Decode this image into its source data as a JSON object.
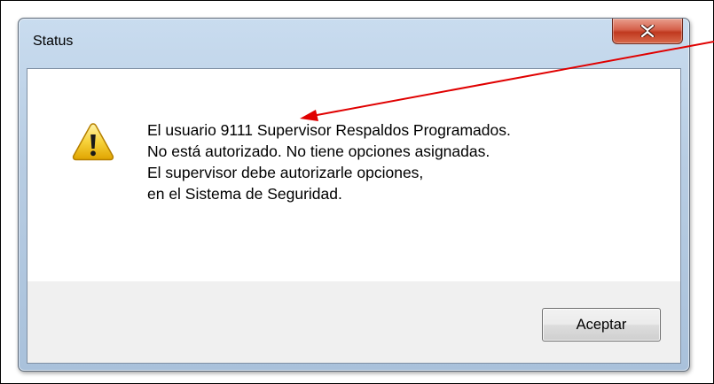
{
  "dialog": {
    "title": "Status",
    "close_icon": "close-icon",
    "warning_icon": "warning-icon",
    "message_lines": [
      "El usuario 9111 Supervisor Respaldos Programados.",
      "No está autorizado.  No tiene opciones asignadas.",
      "El supervisor debe autorizarle opciones,",
      "en el Sistema de Seguridad."
    ],
    "ok_label": "Aceptar"
  },
  "annotation": {
    "arrow_color": "#e00000"
  }
}
